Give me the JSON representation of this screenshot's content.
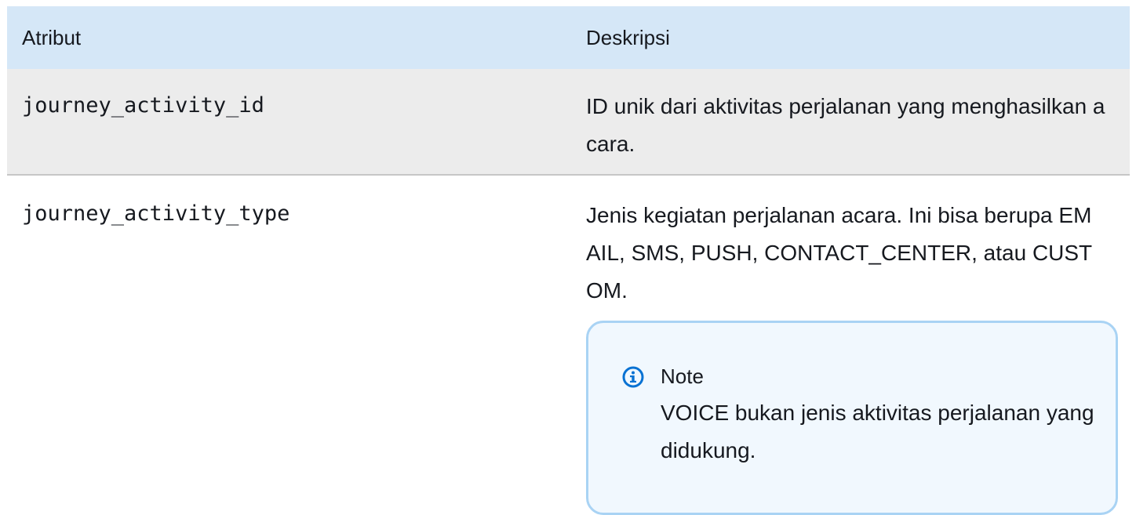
{
  "table": {
    "headers": [
      "Atribut",
      "Deskripsi"
    ],
    "rows": [
      {
        "attribute": "journey_activity_id",
        "description": "ID unik dari aktivitas perjalanan yang menghasilkan acara."
      },
      {
        "attribute": "journey_activity_type",
        "description": "Jenis kegiatan perjalanan acara. Ini bisa berupa EMAIL, SMS, PUSH, CONTACT_CENTER, atau CUSTOM.",
        "note": {
          "icon": "info-icon",
          "title": "Note",
          "body": "VOICE bukan jenis aktivitas perjalanan yang didukung."
        }
      }
    ]
  },
  "colors": {
    "header_bg": "#d5e7f7",
    "row_alt_bg": "#ececec",
    "note_bg": "#f1f8fe",
    "note_border": "#a9d3f4",
    "info_icon": "#0972d3",
    "text": "#16191f"
  }
}
